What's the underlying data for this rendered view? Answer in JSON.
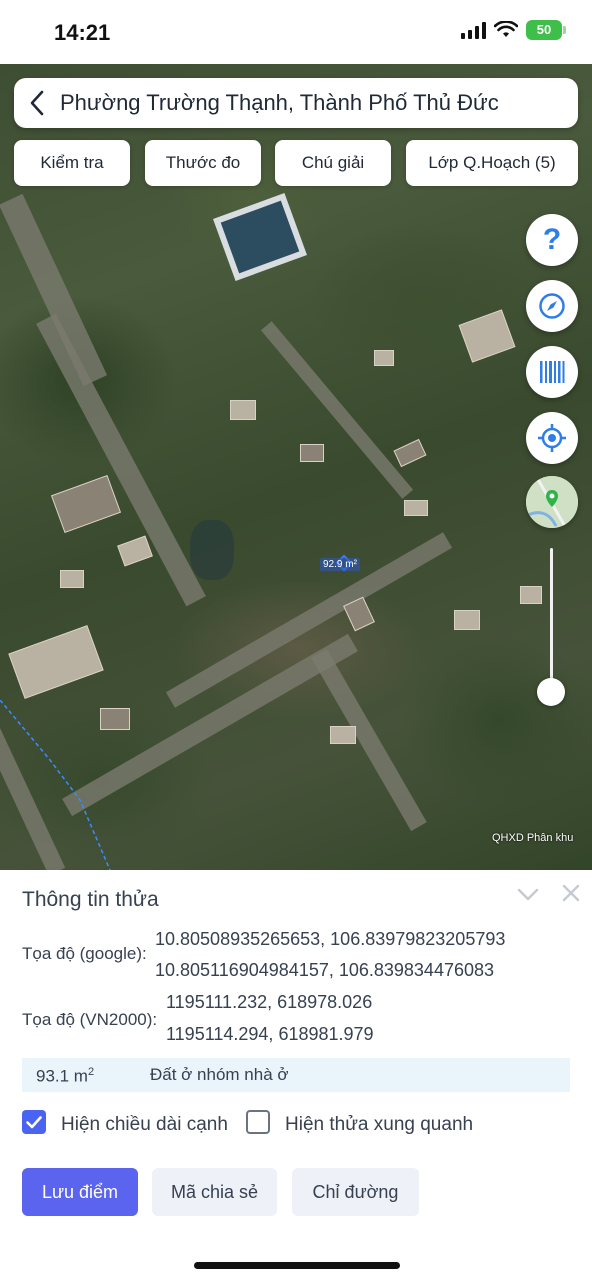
{
  "status_bar": {
    "time": "14:21",
    "battery": "50"
  },
  "header": {
    "title": "Phường Trường Thạnh, Thành Phố Thủ Đức"
  },
  "map_tabs": [
    {
      "label": "Kiểm tra"
    },
    {
      "label": "Thước đo"
    },
    {
      "label": "Chú giải"
    },
    {
      "label": "Lớp Q.Hoạch (5)"
    }
  ],
  "map": {
    "area_label": "92.9 m²",
    "attribution": "QHXD Phân khu",
    "tools": [
      "question-icon",
      "compass-icon",
      "barcode-icon",
      "locate-icon",
      "map-layer-icon"
    ],
    "zoom_level": 0.1
  },
  "panel": {
    "title": "Thông tin thửa",
    "google_label": "Tọa độ (google):",
    "google_coords": [
      "10.80508935265653, 106.83979823205793",
      "10.805116904984157, 106.839834476083"
    ],
    "vn2000_label": "Tọa độ (VN2000):",
    "vn2000_coords": [
      "1195111.232, 618978.026",
      "1195114.294, 618981.979"
    ],
    "area_value": "93.1 m",
    "area_unit_sup": "2",
    "land_type": "Đất ở nhóm nhà ở",
    "show_edge_length": {
      "label": "Hiện chiều dài cạnh",
      "checked": true
    },
    "show_neighbors": {
      "label": "Hiện thửa xung quanh",
      "checked": false
    },
    "buttons": {
      "save": "Lưu điểm",
      "share": "Mã chia sẻ",
      "directions": "Chỉ đường"
    }
  },
  "colors": {
    "primary": "#5a64ee",
    "accent_blue": "#2f7ee8",
    "battery": "#3fbf4a"
  }
}
